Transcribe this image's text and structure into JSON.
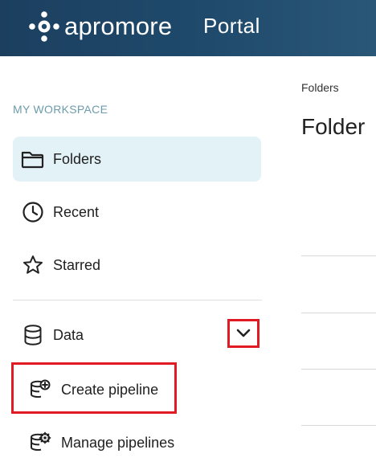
{
  "header": {
    "brand": "apromore",
    "product": "Portal",
    "logo_icon": "apromore-logo-icon",
    "background": "#1f4a6c"
  },
  "sidebar": {
    "section_title": "MY WORKSPACE",
    "items": [
      {
        "label": "Folders",
        "icon": "folder-icon",
        "active": true
      },
      {
        "label": "Recent",
        "icon": "clock-icon",
        "active": false
      },
      {
        "label": "Starred",
        "icon": "star-icon",
        "active": false
      },
      {
        "label": "Data",
        "icon": "database-icon",
        "active": false,
        "expanded": true
      }
    ],
    "data_subitems": [
      {
        "label": "Create pipeline",
        "icon": "create-pipeline-icon"
      },
      {
        "label": "Manage pipelines",
        "icon": "manage-pipelines-icon"
      }
    ],
    "active_bg": "#e3f2f6",
    "highlight_color": "#e01b24"
  },
  "main": {
    "breadcrumb": "Folders",
    "title": "Folder"
  }
}
